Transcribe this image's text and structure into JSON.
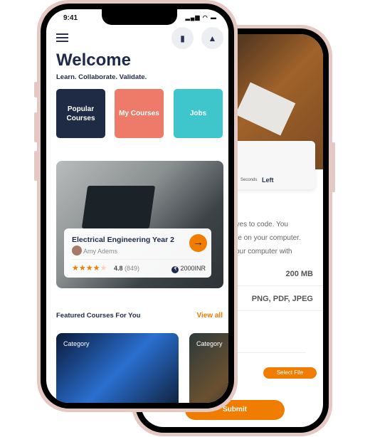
{
  "back_screen": {
    "timer_seconds_label": "Seconds",
    "timer_left_label": "Left",
    "description_lines": [
      "oves to code. You",
      "me on your computer.",
      "your computer with"
    ],
    "max_size": "200 MB",
    "formats": "PNG, PDF, JPEG",
    "select_file_label": "Select File",
    "submit_label": "Submit"
  },
  "status_bar": {
    "time": "9:41"
  },
  "header": {
    "title": "Welcome",
    "tagline": "Learn. Collaborate. Validate."
  },
  "tiles": [
    {
      "label": "Popular Courses",
      "color": "#1f2a44"
    },
    {
      "label": "My Courses",
      "color": "#ee7b6a"
    },
    {
      "label": "Jobs",
      "color": "#3fc5cc"
    }
  ],
  "hero_course": {
    "title": "Electrical Engineering Year 2",
    "author": "Amy Adems",
    "stars": 4,
    "rating": "4.8",
    "reviews": "(849)",
    "price": "2000INR"
  },
  "featured": {
    "title": "Featured Courses For You",
    "view_all": "View all",
    "cards": [
      {
        "category": "Category"
      },
      {
        "category": "Category"
      }
    ]
  },
  "colors": {
    "accent": "#f07d00",
    "navy": "#1f2a4a",
    "frame": "#e3c8c3"
  }
}
